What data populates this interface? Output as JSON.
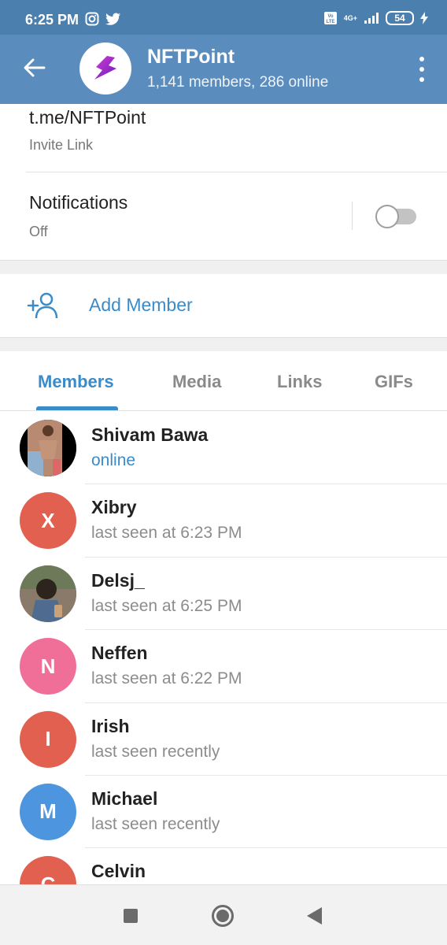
{
  "status_bar": {
    "time": "6:25 PM",
    "battery": "54",
    "network": "4G+"
  },
  "header": {
    "title": "NFTPoint",
    "subtitle": "1,141 members, 286 online"
  },
  "invite": {
    "link": "t.me/NFTPoint",
    "label": "Invite Link"
  },
  "notifications": {
    "title": "Notifications",
    "value": "Off",
    "enabled": false
  },
  "add_member": {
    "label": "Add Member"
  },
  "tabs": [
    {
      "label": "Members",
      "active": true
    },
    {
      "label": "Media",
      "active": false
    },
    {
      "label": "Links",
      "active": false
    },
    {
      "label": "GIFs",
      "active": false
    }
  ],
  "members": [
    {
      "name": "Shivam Bawa",
      "status": "online",
      "initial": "",
      "color": "#5c3d2e",
      "photo": true
    },
    {
      "name": "Xibry",
      "status": "last seen at 6:23 PM",
      "initial": "X",
      "color": "#e2604f"
    },
    {
      "name": "Delsj_",
      "status": "last seen at 6:25 PM",
      "initial": "",
      "color": "#7a6a5a",
      "photo": true
    },
    {
      "name": "Neffen",
      "status": "last seen at 6:22 PM",
      "initial": "N",
      "color": "#ef6f98"
    },
    {
      "name": "Irish",
      "status": "last seen recently",
      "initial": "I",
      "color": "#e2604f"
    },
    {
      "name": "Michael",
      "status": "last seen recently",
      "initial": "M",
      "color": "#4d95de"
    },
    {
      "name": "Celvin",
      "status": "",
      "initial": "C",
      "color": "#e2604f"
    }
  ],
  "colors": {
    "header": "#5a8dbd",
    "accent": "#3a8bc9"
  }
}
